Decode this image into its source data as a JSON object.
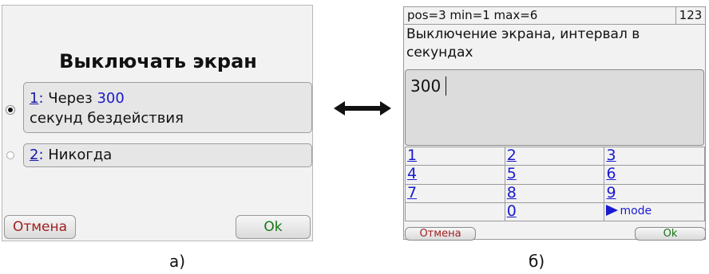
{
  "panel_a": {
    "title": "Выключать экран",
    "options": [
      {
        "number": "1",
        "colon": ":",
        "text_before": " Через ",
        "value": "300",
        "text_line2": "секунд бездействия",
        "selected": true
      },
      {
        "number": "2",
        "colon": ":",
        "text": " Никогда",
        "selected": false
      }
    ],
    "cancel_label": "Отмена",
    "ok_label": "Ok"
  },
  "arrow_icon": "double-arrow-icon",
  "panel_b": {
    "status": "pos=3 min=1 max=6",
    "mode_indicator": "123",
    "description": "Выключение экрана, интервал в секундах",
    "input_value": "300",
    "keypad": {
      "k1": "1",
      "k2": "2",
      "k3": "3",
      "k4": "4",
      "k5": "5",
      "k6": "6",
      "k7": "7",
      "k8": "8",
      "k9": "9",
      "k0": "0",
      "mode": "mode"
    },
    "cancel_label": "Отмена",
    "ok_label": "Ok"
  },
  "captions": {
    "a": "а)",
    "b": "б)"
  },
  "colors": {
    "link_blue": "#1a1ad0",
    "cancel_red": "#a02020",
    "ok_green": "#147814",
    "panel_bg": "#f2f2f2"
  }
}
